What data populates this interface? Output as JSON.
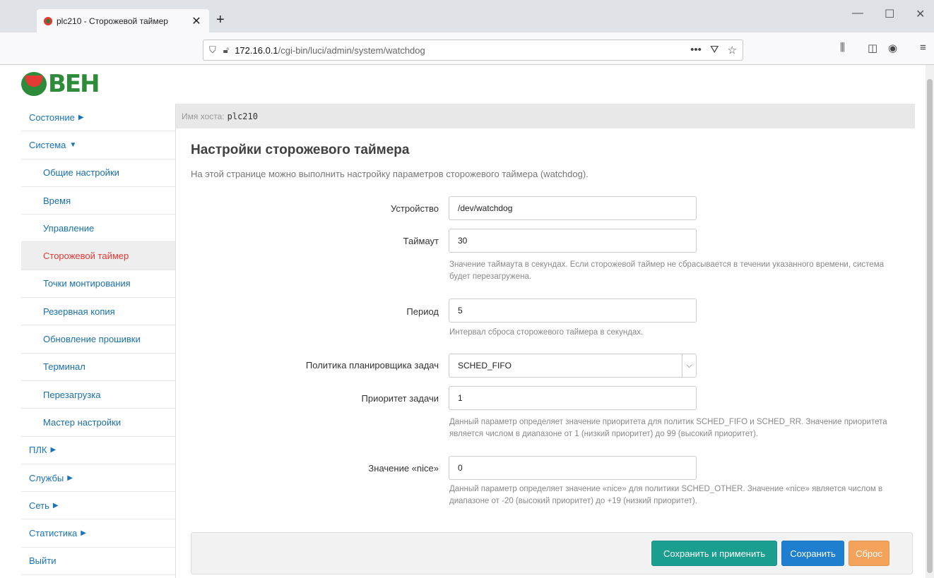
{
  "browser": {
    "tab_title": "plc210 - Сторожевой таймер",
    "tab_close": "✕",
    "new_tab": "+",
    "url_host": "172.16.0.1",
    "url_path": "/cgi-bin/luci/admin/system/watchdog",
    "url_more": "•••"
  },
  "logo": {
    "text": "ВЕН"
  },
  "hostbar": {
    "label": "Имя хоста:",
    "value": "plc210"
  },
  "sidebar": {
    "items": [
      {
        "label": "Состояние",
        "arrow": "▶"
      },
      {
        "label": "Система",
        "arrow": "▼"
      },
      {
        "label": "Общие настройки"
      },
      {
        "label": "Время"
      },
      {
        "label": "Управление"
      },
      {
        "label": "Сторожевой таймер"
      },
      {
        "label": "Точки монтирования"
      },
      {
        "label": "Резервная копия"
      },
      {
        "label": "Обновление прошивки"
      },
      {
        "label": "Терминал"
      },
      {
        "label": "Перезагрузка"
      },
      {
        "label": "Мастер настройки"
      },
      {
        "label": "ПЛК",
        "arrow": "▶"
      },
      {
        "label": "Службы",
        "arrow": "▶"
      },
      {
        "label": "Сеть",
        "arrow": "▶"
      },
      {
        "label": "Статистика",
        "arrow": "▶"
      },
      {
        "label": "Выйти"
      }
    ]
  },
  "main": {
    "title": "Настройки сторожевого таймера",
    "description": "На этой странице можно выполнить настройку параметров сторожевого таймера (watchdog).",
    "device": {
      "label": "Устройство",
      "value": "/dev/watchdog"
    },
    "timeout": {
      "label": "Таймаут",
      "value": "30",
      "hint": "Значение таймаута в секундах. Если сторожевой таймер не сбрасывается в течении указанного времени, система будет перезагружена."
    },
    "period": {
      "label": "Период",
      "value": "5",
      "hint": "Интервал сброса сторожевого таймера в секундах."
    },
    "policy": {
      "label": "Политика планировщика задач",
      "value": "SCHED_FIFO"
    },
    "priority": {
      "label": "Приоритет задачи",
      "value": "1",
      "hint": "Данный параметр определяет значение приоритета для политик SCHED_FIFO и SCHED_RR. Значение приоритета является числом в диапазоне от 1 (низкий приоритет) до 99 (высокий приоритет)."
    },
    "nice": {
      "label": "Значение «nice»",
      "value": "0",
      "hint": "Данный параметр определяет значение «nice» для политики SCHED_OTHER. Значение «nice» является числом в диапазоне от -20 (высокий приоритет) до +19 (низкий приоритет)."
    },
    "buttons": {
      "apply": "Сохранить и применить",
      "save": "Сохранить",
      "reset": "Сброс"
    }
  },
  "colors": {
    "apply": "#1a9e8f",
    "save": "#1e7fd0",
    "reset": "#f5a25a",
    "active_menu": "#e53935",
    "link": "#1a73b8"
  }
}
